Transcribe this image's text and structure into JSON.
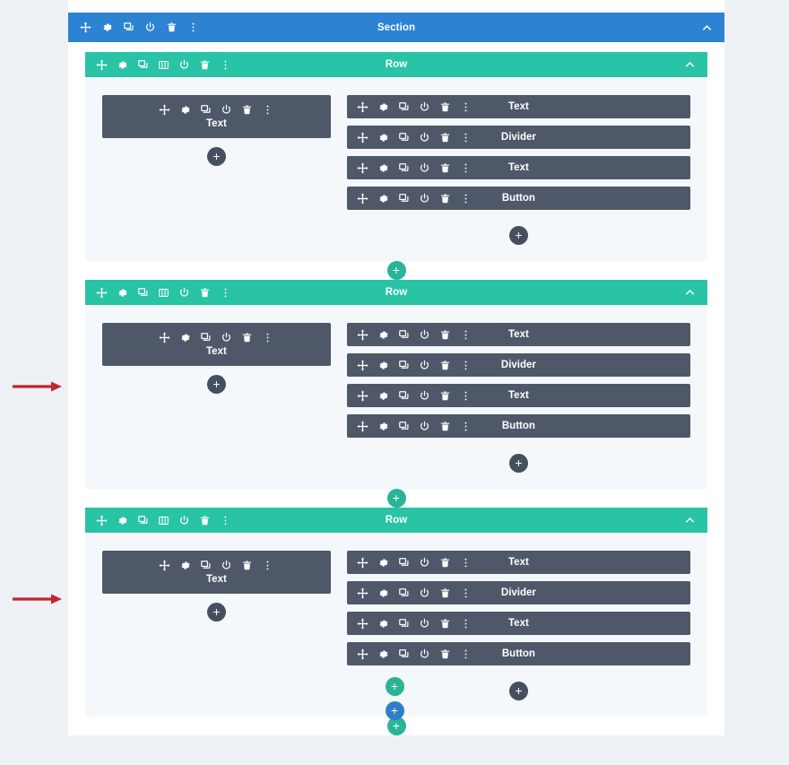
{
  "app": {
    "name": "Divi Visual Builder Wireframe",
    "canvas_background": "#ffffff",
    "page_background": "#eef2f7"
  },
  "colors": {
    "section": "#2d83d2",
    "row": "#29c3a6",
    "module": "#4e5868",
    "add_module": "#454f5f",
    "add_row": "#29b497",
    "add_section": "#2d7fcc",
    "row_body": "#f4f8fb",
    "arrow": "#c1272d"
  },
  "icons": {
    "move": "move-icon",
    "settings": "gear-icon",
    "duplicate": "duplicate-icon",
    "columns": "columns-icon",
    "toggle": "power-icon",
    "delete": "trash-icon",
    "more": "vertical-dots-icon",
    "collapse": "chevron-up-icon",
    "add": "plus-icon"
  },
  "section": {
    "label": "Section",
    "toolbar": [
      "move-icon",
      "gear-icon",
      "duplicate-icon",
      "power-icon",
      "trash-icon",
      "vertical-dots-icon"
    ],
    "collapse_label": "⌃"
  },
  "row_toolbar": [
    "move-icon",
    "gear-icon",
    "duplicate-icon",
    "columns-icon",
    "power-icon",
    "trash-icon",
    "vertical-dots-icon"
  ],
  "module_toolbar": [
    "move-icon",
    "gear-icon",
    "duplicate-icon",
    "power-icon",
    "trash-icon",
    "vertical-dots-icon"
  ],
  "add_labels": {
    "add_module": "+",
    "add_row": "+",
    "add_section": "+"
  },
  "rows": [
    {
      "label": "Row",
      "left_column": {
        "modules": [
          {
            "label": "Text"
          }
        ]
      },
      "right_column": {
        "modules": [
          {
            "label": "Text"
          },
          {
            "label": "Divider"
          },
          {
            "label": "Text"
          },
          {
            "label": "Button"
          }
        ]
      }
    },
    {
      "label": "Row",
      "left_column": {
        "modules": [
          {
            "label": "Text"
          }
        ]
      },
      "right_column": {
        "modules": [
          {
            "label": "Text"
          },
          {
            "label": "Divider"
          },
          {
            "label": "Text"
          },
          {
            "label": "Button"
          }
        ]
      }
    },
    {
      "label": "Row",
      "left_column": {
        "modules": [
          {
            "label": "Text"
          }
        ]
      },
      "right_column": {
        "modules": [
          {
            "label": "Text"
          },
          {
            "label": "Divider"
          },
          {
            "label": "Text"
          },
          {
            "label": "Button"
          }
        ]
      }
    }
  ],
  "annotations": [
    {
      "name": "arrow-1",
      "shape": "right-arrow",
      "color": "#c1272d"
    },
    {
      "name": "arrow-2",
      "shape": "right-arrow",
      "color": "#c1272d"
    }
  ]
}
